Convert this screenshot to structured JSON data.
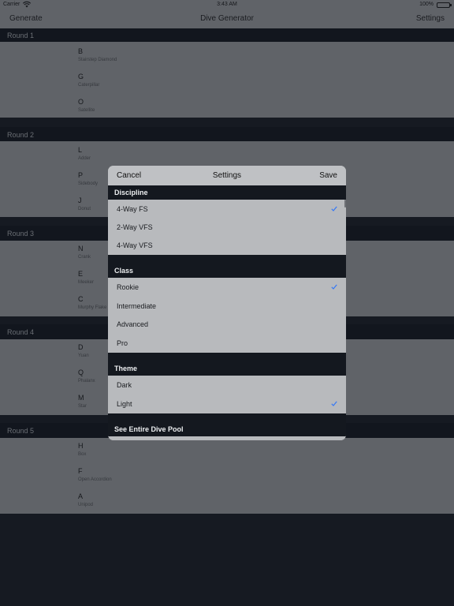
{
  "status_bar": {
    "carrier": "Carrier",
    "time": "3:43 AM",
    "battery": "100%",
    "icons": [
      "wifi-icon",
      "battery-icon"
    ]
  },
  "nav_bar": {
    "left": "Generate",
    "title": "Dive Generator",
    "right": "Settings"
  },
  "rounds": [
    {
      "label": "Round 1",
      "dives": [
        {
          "letter": "B",
          "name": "Stairstep Diamond"
        },
        {
          "letter": "G",
          "name": "Caterpillar"
        },
        {
          "letter": "O",
          "name": "Satellite"
        }
      ]
    },
    {
      "label": "Round 2",
      "dives": [
        {
          "letter": "L",
          "name": "Adder"
        },
        {
          "letter": "P",
          "name": "Sidebody"
        },
        {
          "letter": "J",
          "name": "Donut"
        }
      ]
    },
    {
      "label": "Round 3",
      "dives": [
        {
          "letter": "N",
          "name": "Crank"
        },
        {
          "letter": "E",
          "name": "Meeker"
        },
        {
          "letter": "C",
          "name": "Murphy Flake"
        }
      ]
    },
    {
      "label": "Round 4",
      "dives": [
        {
          "letter": "D",
          "name": "Yuan"
        },
        {
          "letter": "Q",
          "name": "Phalanx"
        },
        {
          "letter": "M",
          "name": "Star"
        }
      ]
    },
    {
      "label": "Round 5",
      "dives": [
        {
          "letter": "H",
          "name": "Box"
        },
        {
          "letter": "F",
          "name": "Open Accordion"
        },
        {
          "letter": "A",
          "name": "Unipod"
        }
      ]
    }
  ],
  "settings": {
    "cancel": "Cancel",
    "title": "Settings",
    "save": "Save",
    "discipline": {
      "header": "Discipline",
      "options": [
        "4-Way FS",
        "2-Way VFS",
        "4-Way VFS"
      ],
      "selected": "4-Way FS"
    },
    "class": {
      "header": "Class",
      "options": [
        "Rookie",
        "Intermediate",
        "Advanced",
        "Pro"
      ],
      "selected": "Rookie"
    },
    "theme": {
      "header": "Theme",
      "options": [
        "Dark",
        "Light"
      ],
      "selected": "Light"
    },
    "dive_pool": "See Entire Dive Pool",
    "check_color": "#3478f6"
  }
}
